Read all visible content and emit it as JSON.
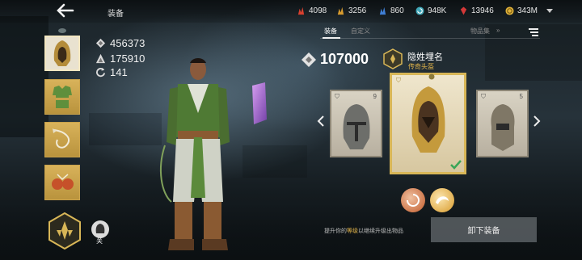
{
  "header": {
    "title": "装备",
    "resources": [
      {
        "icon": "red-claw-icon",
        "value": "4098",
        "color": "#d8402f"
      },
      {
        "icon": "gold-claw-icon",
        "value": "3256",
        "color": "#d79b2e"
      },
      {
        "icon": "blue-claw-icon",
        "value": "860",
        "color": "#3f7fd6"
      },
      {
        "icon": "swirl-coin-icon",
        "value": "948K",
        "color": "#3fa7b8"
      },
      {
        "icon": "red-gem-icon",
        "value": "13946",
        "color": "#d33838"
      },
      {
        "icon": "gold-coin-icon",
        "value": "343M",
        "color": "#e0b23a"
      }
    ]
  },
  "stats": {
    "attack": "456373",
    "defense": "175910",
    "cycle": "141"
  },
  "slots": [
    {
      "name": "helmet",
      "selected": true
    },
    {
      "name": "armor",
      "selected": false
    },
    {
      "name": "weapon",
      "selected": false
    },
    {
      "name": "accessory",
      "selected": false
    }
  ],
  "mute_label": "关",
  "tabs": {
    "equipment": "装备",
    "custom": "自定义",
    "collection": "物品集"
  },
  "item": {
    "power": "107000",
    "name": "隐姓埋名",
    "rarity": "传奇头盔",
    "left_card_level": "9",
    "right_card_level": "5"
  },
  "hint": {
    "before": "提升你的",
    "highlight": "等级",
    "after": "以继续升级出物品"
  },
  "unequip_label": "卸下装备",
  "colors": {
    "accent_gold": "#d8b657",
    "rarity_gold": "#e3b54a",
    "button_grey": "#5a6064"
  }
}
